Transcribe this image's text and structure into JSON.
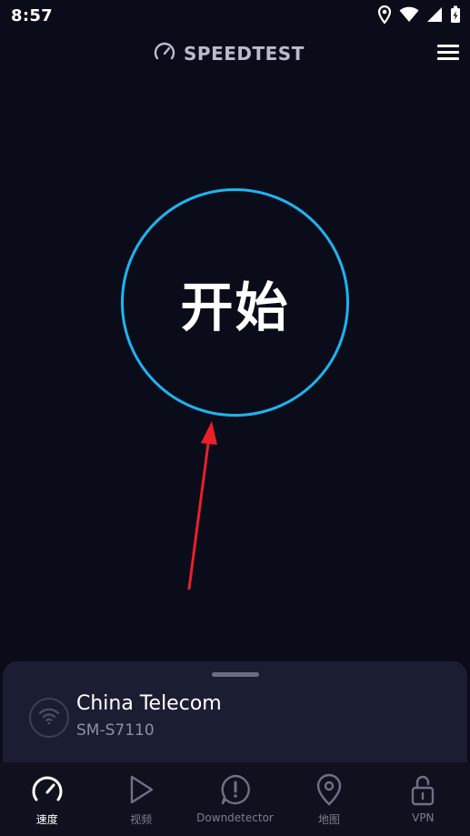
{
  "status_bar": {
    "time": "8:57",
    "icons": [
      "location-icon",
      "wifi-icon",
      "cellular-signal-icon",
      "battery-charging-icon"
    ]
  },
  "header": {
    "brand": "SPEEDTEST",
    "brand_icon": "speedometer-logo-icon",
    "menu_icon": "hamburger-menu-icon"
  },
  "main": {
    "start_button_label": "开始",
    "ring_color": "#1eb4f0",
    "annotation_arrow_color": "#e8202a"
  },
  "connection": {
    "provider": "China Telecom",
    "device": "SM-S7110",
    "icon": "wifi-icon"
  },
  "bottom_nav": {
    "items": [
      {
        "label": "速度",
        "icon": "speedometer-icon",
        "active": true
      },
      {
        "label": "视频",
        "icon": "play-icon",
        "active": false
      },
      {
        "label": "Downdetector",
        "icon": "alert-icon",
        "active": false
      },
      {
        "label": "地图",
        "icon": "map-pin-icon",
        "active": false
      },
      {
        "label": "VPN",
        "icon": "lock-icon",
        "active": false
      }
    ]
  },
  "colors": {
    "background": "#0b0c1a",
    "sheet": "#1b1d33",
    "nav_background": "#10111e",
    "accent": "#1eb4f0"
  }
}
